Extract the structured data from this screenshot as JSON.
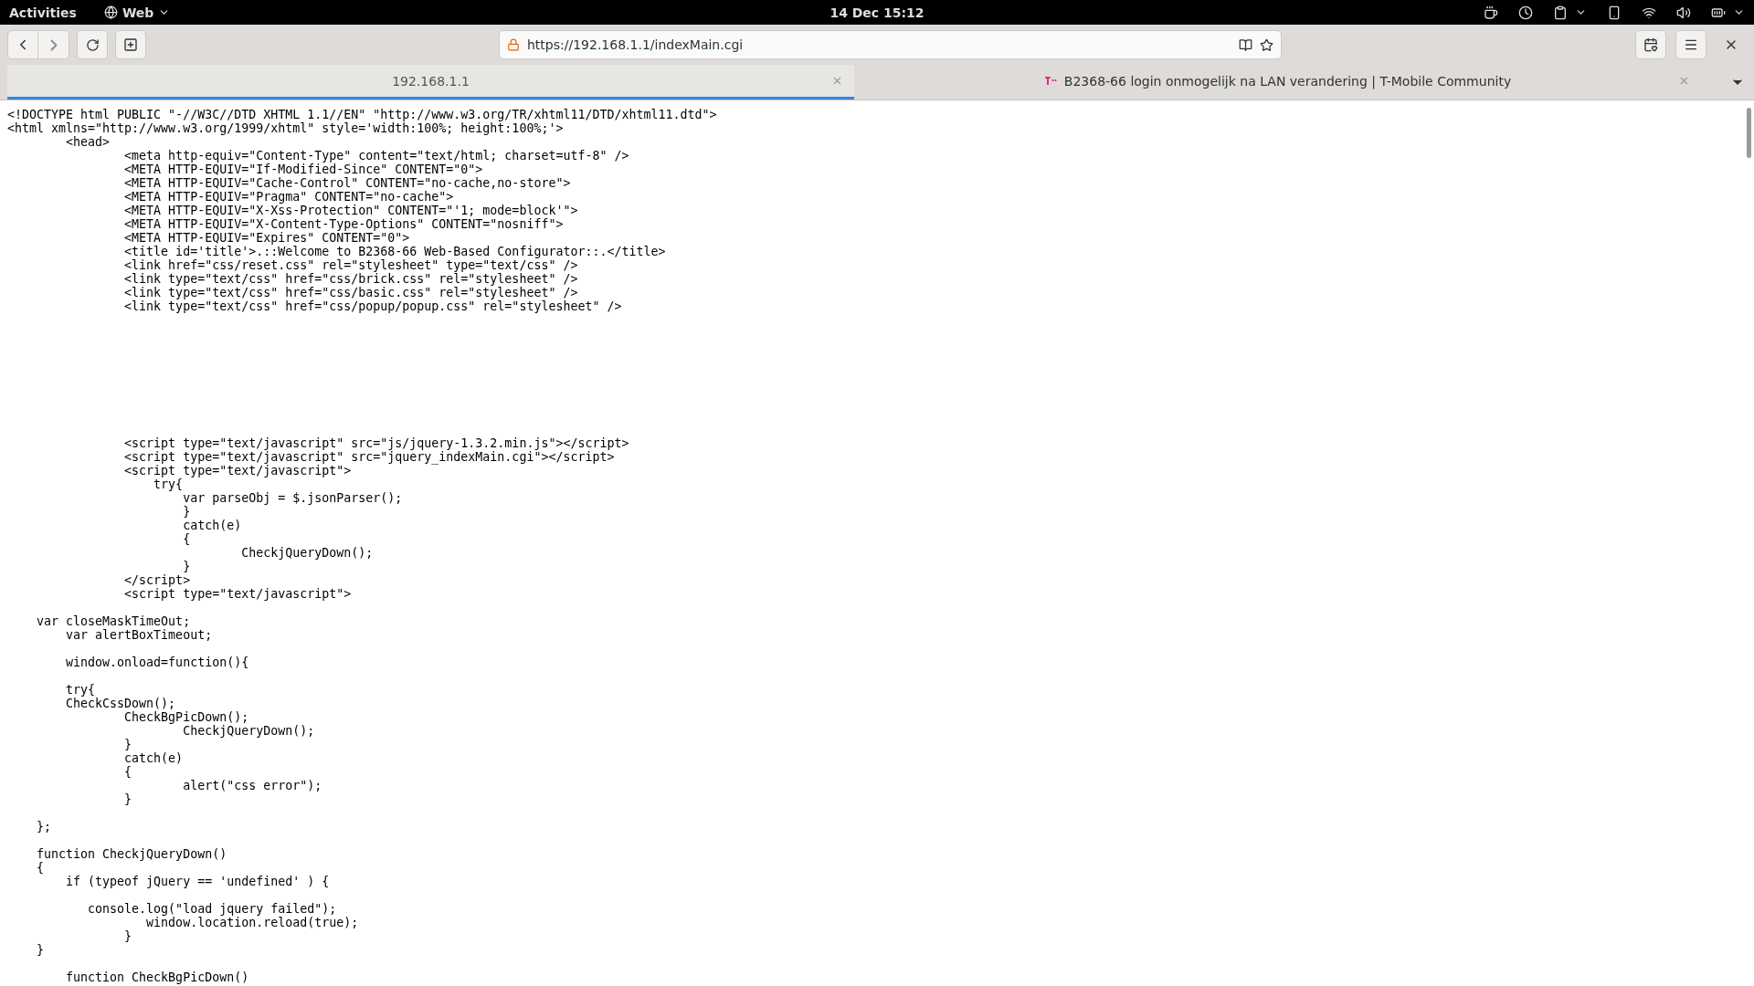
{
  "top_bar": {
    "activities": "Activities",
    "app_menu": "Web",
    "clock": "14 Dec 15:12"
  },
  "toolbar": {
    "address": "https://192.168.1.1/indexMain.cgi"
  },
  "tabs": [
    {
      "title": "192.168.1.1",
      "selected": true,
      "favicon": false
    },
    {
      "title": "B2368-66 login onmogelijk na LAN verandering | T-Mobile Community",
      "selected": false,
      "favicon": true
    }
  ],
  "source": {
    "lines": [
      {
        "kind": "code",
        "text": "<!DOCTYPE html PUBLIC \"-//W3C//DTD XHTML 1.1//EN\" \"http://www.w3.org/TR/xhtml11/DTD/xhtml11.dtd\">"
      },
      {
        "kind": "code",
        "text": "<html xmlns=\"http://www.w3.org/1999/xhtml\" style='width:100%; height:100%;'>"
      },
      {
        "kind": "code",
        "text": "        <head>"
      },
      {
        "kind": "code",
        "text": "                <meta http-equiv=\"Content-Type\" content=\"text/html; charset=utf-8\" />"
      },
      {
        "kind": "code",
        "text": "                <META HTTP-EQUIV=\"If-Modified-Since\" CONTENT=\"0\">"
      },
      {
        "kind": "code",
        "text": "                <META HTTP-EQUIV=\"Cache-Control\" CONTENT=\"no-cache,no-store\">"
      },
      {
        "kind": "code",
        "text": "                <META HTTP-EQUIV=\"Pragma\" CONTENT=\"no-cache\">"
      },
      {
        "kind": "code",
        "text": "                <META HTTP-EQUIV=\"X-Xss-Protection\" CONTENT=\"'1; mode=block'\">"
      },
      {
        "kind": "code",
        "text": "                <META HTTP-EQUIV=\"X-Content-Type-Options\" CONTENT=\"nosniff\">"
      },
      {
        "kind": "code",
        "text": "                <META HTTP-EQUIV=\"Expires\" CONTENT=\"0\">"
      },
      {
        "kind": "code",
        "text": "                <title id='title'>.::Welcome to B2368-66 Web-Based Configurator::.</title>"
      },
      {
        "kind": "code",
        "text": "                <link href=\"css/reset.css\" rel=\"stylesheet\" type=\"text/css\" />"
      },
      {
        "kind": "code",
        "text": "                <link type=\"text/css\" href=\"css/brick.css\" rel=\"stylesheet\" />"
      },
      {
        "kind": "code",
        "text": "                <link type=\"text/css\" href=\"css/basic.css\" rel=\"stylesheet\" />"
      },
      {
        "kind": "code",
        "text": "                <link type=\"text/css\" href=\"css/popup/popup.css\" rel=\"stylesheet\" />"
      },
      {
        "kind": "blank"
      },
      {
        "kind": "blank"
      },
      {
        "kind": "blank"
      },
      {
        "kind": "blank"
      },
      {
        "kind": "blank"
      },
      {
        "kind": "blank"
      },
      {
        "kind": "blank"
      },
      {
        "kind": "blank"
      },
      {
        "kind": "blank"
      },
      {
        "kind": "code",
        "text": "                <script type=\"text/javascript\" src=\"js/jquery-1.3.2.min.js\"></script>"
      },
      {
        "kind": "code",
        "text": "                <script type=\"text/javascript\" src=\"jquery_indexMain.cgi\"></script>"
      },
      {
        "kind": "code",
        "text": "                <script type=\"text/javascript\">"
      },
      {
        "kind": "code",
        "text": "                    try{"
      },
      {
        "kind": "code",
        "text": "                        var parseObj = $.jsonParser();"
      },
      {
        "kind": "code",
        "text": "                        }"
      },
      {
        "kind": "code",
        "text": "                        catch(e)"
      },
      {
        "kind": "code",
        "text": "                        {"
      },
      {
        "kind": "code",
        "text": "                                CheckjQueryDown();"
      },
      {
        "kind": "code",
        "text": "                        }"
      },
      {
        "kind": "code",
        "text": "                </script>"
      },
      {
        "kind": "code",
        "text": "                <script type=\"text/javascript\">"
      },
      {
        "kind": "blank"
      },
      {
        "kind": "code",
        "text": "    var closeMaskTimeOut;"
      },
      {
        "kind": "code",
        "text": "        var alertBoxTimeout;"
      },
      {
        "kind": "blank"
      },
      {
        "kind": "code",
        "text": "        window.onload=function(){"
      },
      {
        "kind": "blank"
      },
      {
        "kind": "code",
        "text": "        try{"
      },
      {
        "kind": "code",
        "text": "        CheckCssDown();"
      },
      {
        "kind": "code",
        "text": "                CheckBgPicDown();"
      },
      {
        "kind": "code",
        "text": "                        CheckjQueryDown();"
      },
      {
        "kind": "code",
        "text": "                }"
      },
      {
        "kind": "code",
        "text": "                catch(e)"
      },
      {
        "kind": "code",
        "text": "                {"
      },
      {
        "kind": "code",
        "text": "                        alert(\"css error\");"
      },
      {
        "kind": "code",
        "text": "                }"
      },
      {
        "kind": "blank"
      },
      {
        "kind": "code",
        "text": "    };"
      },
      {
        "kind": "blank"
      },
      {
        "kind": "code",
        "text": "    function CheckjQueryDown()"
      },
      {
        "kind": "code",
        "text": "    {"
      },
      {
        "kind": "code",
        "text": "        if (typeof jQuery == 'undefined' ) {"
      },
      {
        "kind": "blank"
      },
      {
        "kind": "code",
        "text": "           console.log(\"load jquery failed\");"
      },
      {
        "kind": "code",
        "text": "                   window.location.reload(true);"
      },
      {
        "kind": "code",
        "text": "                }"
      },
      {
        "kind": "code",
        "text": "    }"
      },
      {
        "kind": "blank"
      },
      {
        "kind": "code",
        "text": "        function CheckBgPicDown()"
      }
    ]
  }
}
